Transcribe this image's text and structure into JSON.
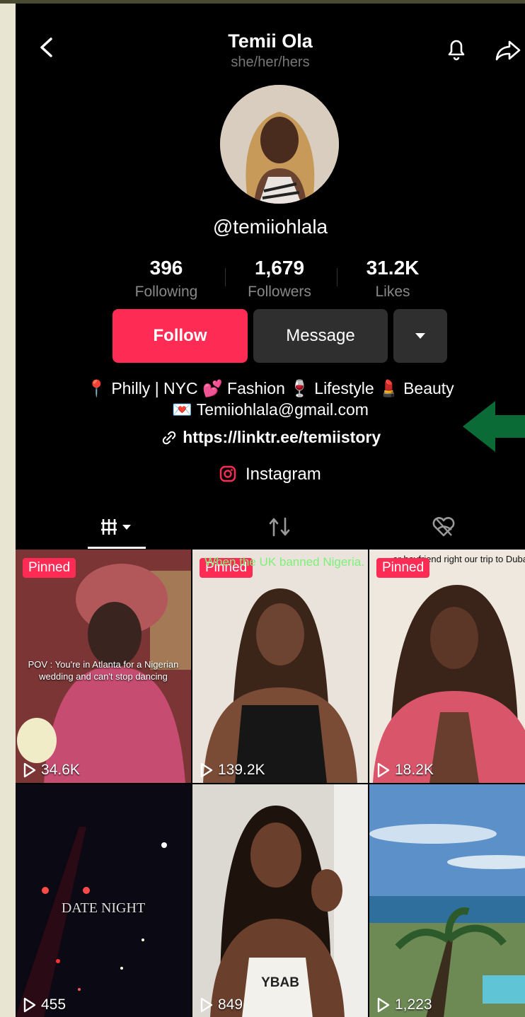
{
  "profile": {
    "name": "Temii Ola",
    "pronouns": "she/her/hers",
    "handle": "@temiiohlala"
  },
  "stats": [
    {
      "value": "396",
      "label": "Following"
    },
    {
      "value": "1,679",
      "label": "Followers"
    },
    {
      "value": "31.2K",
      "label": "Likes"
    }
  ],
  "buttons": {
    "follow": "Follow",
    "message": "Message"
  },
  "bio": {
    "line1": "📍 Philly | NYC 💕 Fashion 🍷 Lifestyle 💄 Beauty",
    "line2": "💌 Temiiohlala@gmail.com",
    "link": "https://linktr.ee/temiistory",
    "instagram": "Instagram"
  },
  "colors": {
    "accent": "#fe2c55",
    "arrow": "#0b6b36"
  },
  "videos": [
    {
      "pinned": "Pinned",
      "views": "34.6K",
      "caption": "POV : You're in Atlanta for a Nigerian wedding and can't stop dancing",
      "bg": "#6b2f2d"
    },
    {
      "pinned": "Pinned",
      "views": "139.2K",
      "caption": "When the UK banned Nigeria.",
      "bg": "#e8e2da"
    },
    {
      "pinned": "Pinned",
      "views": "18.2K",
      "caption": "er boyfriend right our trip to Dubai",
      "bg": "#eee7dc"
    },
    {
      "views": "455",
      "caption": "DATE NIGHT",
      "bg": "#0c0a14"
    },
    {
      "views": "849",
      "caption": "YBAB",
      "bg": "#d9d5cf"
    },
    {
      "views": "1,223",
      "bg": "#5c8fc4"
    }
  ]
}
